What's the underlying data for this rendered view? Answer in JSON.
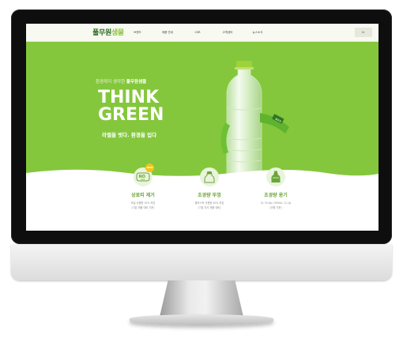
{
  "nav": {
    "logo": "풀무원",
    "logo_leaf": "샘물",
    "menu": [
      "브랜드",
      "제품 안내",
      "CSR",
      "고객센터",
      "뉴스소식"
    ],
    "button_label": "Kr"
  },
  "hero": {
    "subtitle_prefix": "환경까지 생각한",
    "subtitle_brand": "풀무원샘물",
    "headline_line1": "THINK",
    "headline_line2": "GREEN",
    "tagline": "라벨을 벗다. 환경을 입다",
    "badge_text": "풀무원"
  },
  "features": [
    {
      "icon": "no-label-icon",
      "badge": "NEW",
      "icon_text": "NO",
      "icon_sub": "label",
      "title": "상표띠 제거",
      "desc1": "비닐 사용량 15% 저감",
      "desc2": "(기존 제품 대비 기준)"
    },
    {
      "icon": "bottle-cap-icon",
      "title": "초경량 뚜껑",
      "desc1": "플라스틱 사용량 40% 저감",
      "desc2": "(기존 자사 제품 대비)"
    },
    {
      "icon": "light-bottle-icon",
      "title": "초경량 용기",
      "desc1": "2L 32.6g | 500mL 11.1g",
      "desc2": "(신병 기준)"
    }
  ],
  "colors": {
    "brand_green": "#84c73c",
    "dark_green": "#2b6b23",
    "accent_yellow": "#f2c517"
  }
}
